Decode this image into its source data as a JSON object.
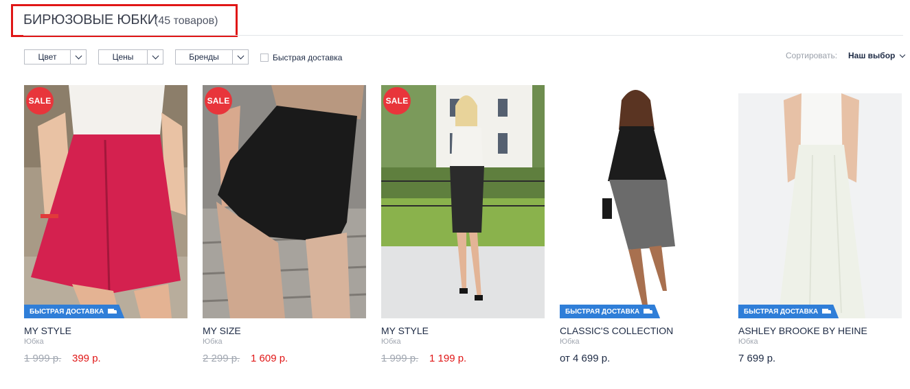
{
  "header": {
    "title": "БИРЮЗОВЫЕ ЮБКИ",
    "count": "(45 товаров)"
  },
  "filters": {
    "color": "Цвет",
    "prices": "Цены",
    "brands": "Бренды",
    "fast_delivery": "Быстрая доставка"
  },
  "sort": {
    "label": "Сортировать:",
    "value": "Наш выбор"
  },
  "badges": {
    "sale": "SALE",
    "fast": "БЫСТРАЯ ДОСТАВКА"
  },
  "products": [
    {
      "brand": "MY STYLE",
      "type": "Юбка",
      "old_price": "1 999 р.",
      "price": "399 р.",
      "sale": true,
      "skirt_color": "#d4214f"
    },
    {
      "brand": "MY SIZE",
      "type": "Юбка",
      "old_price": "2 299 р.",
      "price": "1 609 р.",
      "sale": true,
      "skirt_color": "#1a1a1a"
    },
    {
      "brand": "MY STYLE",
      "type": "Юбка",
      "old_price": "1 999 р.",
      "price": "1 199 р.",
      "sale": true,
      "skirt_color": "#2b2b2b"
    },
    {
      "brand": "CLASSIC'S COLLECTION",
      "type": "Юбка",
      "price": "от 4 699 р.",
      "sale": false,
      "skirt_color": "#6b6b6b"
    },
    {
      "brand": "ASHLEY BROOKE BY HEINE",
      "type": "Юбка",
      "price": "7 699 р.",
      "sale": false,
      "skirt_color": "#eef1e8"
    }
  ]
}
